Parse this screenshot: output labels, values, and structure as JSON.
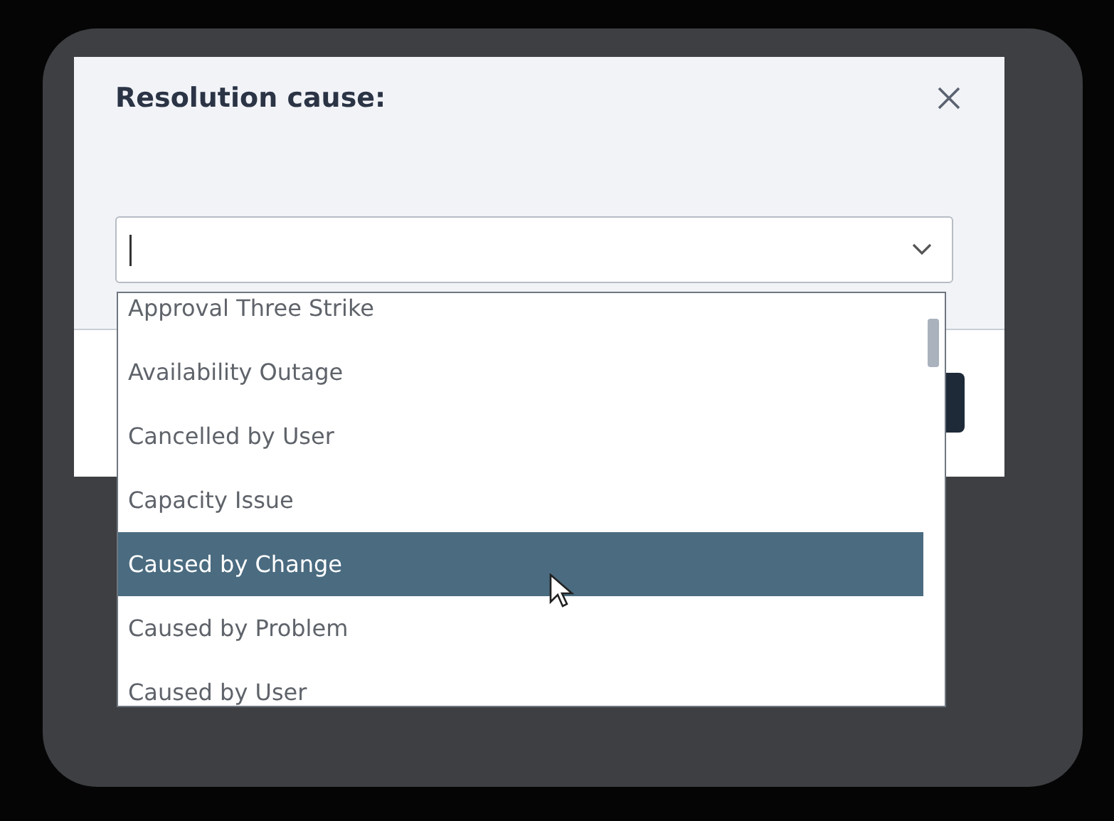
{
  "dialog": {
    "title": "Resolution cause:"
  },
  "dropdown": {
    "options": [
      {
        "label": "Approval Three Strike",
        "selected": false
      },
      {
        "label": "Availability Outage",
        "selected": false
      },
      {
        "label": "Cancelled by User",
        "selected": false
      },
      {
        "label": "Capacity Issue",
        "selected": false
      },
      {
        "label": "Caused by Change",
        "selected": true
      },
      {
        "label": "Caused by Problem",
        "selected": false
      },
      {
        "label": "Caused by User",
        "selected": false
      }
    ]
  }
}
